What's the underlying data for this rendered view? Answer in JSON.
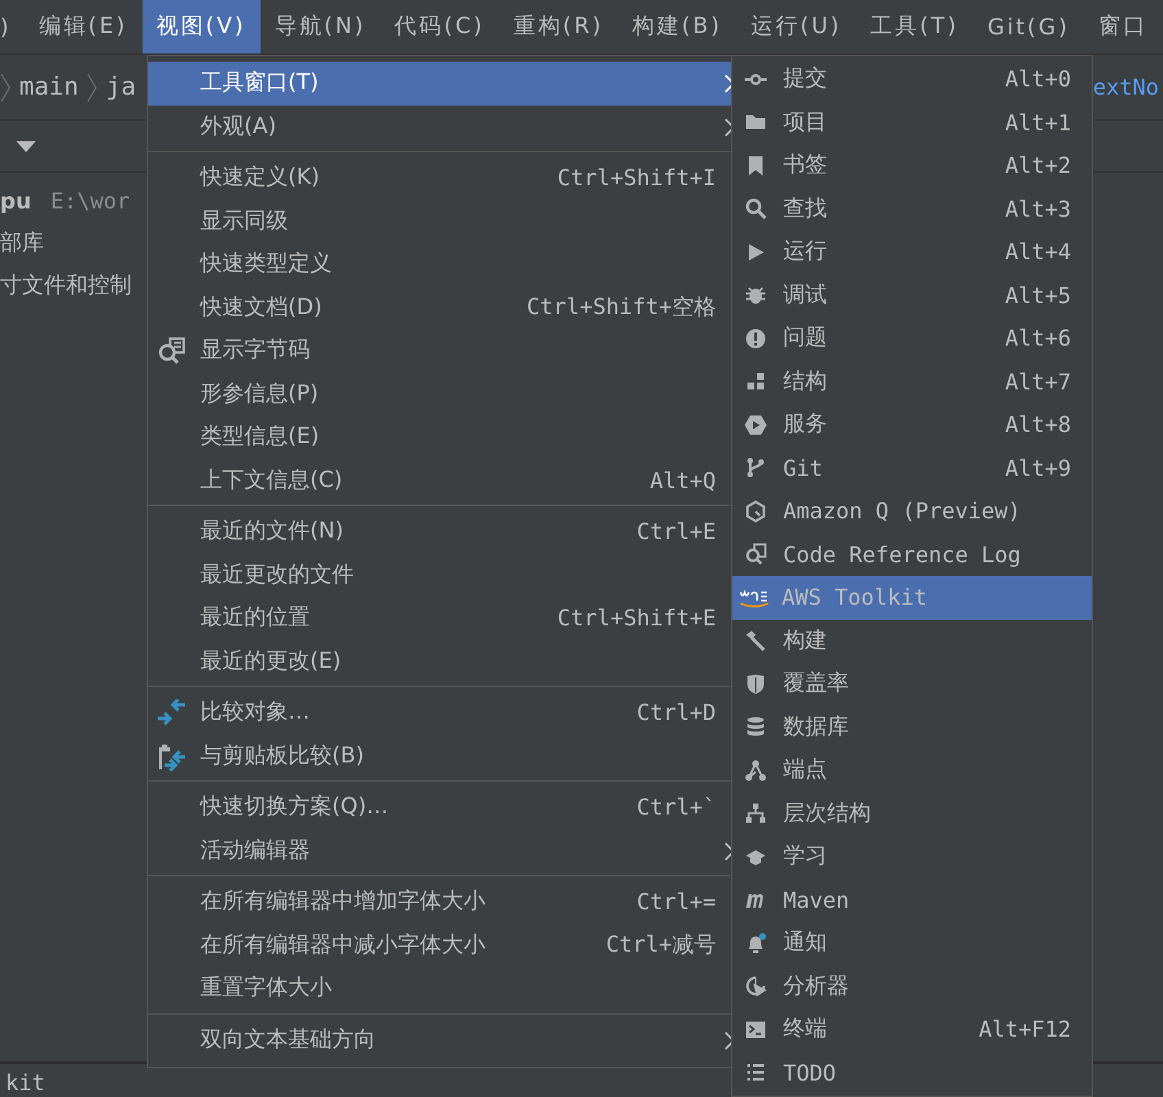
{
  "menubar": {
    "items": [
      {
        "label": ")",
        "selected": false
      },
      {
        "label": "编辑(E)",
        "selected": false
      },
      {
        "label": "视图(V)",
        "selected": true
      },
      {
        "label": "导航(N)",
        "selected": false
      },
      {
        "label": "代码(C)",
        "selected": false
      },
      {
        "label": "重构(R)",
        "selected": false
      },
      {
        "label": "构建(B)",
        "selected": false
      },
      {
        "label": "运行(U)",
        "selected": false
      },
      {
        "label": "工具(T)",
        "selected": false
      },
      {
        "label": "Git(G)",
        "selected": false
      },
      {
        "label": "窗口",
        "selected": false
      }
    ]
  },
  "breadcrumb": {
    "items": [
      "main",
      "ja"
    ],
    "link": "extNo"
  },
  "project_tree": {
    "root": {
      "name": "pu",
      "path": "E:\\wor"
    },
    "items": [
      "部库",
      "寸文件和控制"
    ]
  },
  "bottom_panel": {
    "title": "kit"
  },
  "view_menu": {
    "groups": [
      [
        {
          "label": "工具窗口(T)",
          "selected": true,
          "submenu": true
        },
        {
          "label": "外观(A)",
          "selected": false,
          "submenu": true
        }
      ],
      [
        {
          "label": "快速定义(K)",
          "shortcut": "Ctrl+Shift+I",
          "selected": false,
          "submenu": false
        },
        {
          "label": "显示同级",
          "selected": false,
          "submenu": false
        },
        {
          "label": "快速类型定义",
          "selected": false,
          "submenu": false
        },
        {
          "label": "快速文档(D)",
          "shortcut": "Ctrl+Shift+空格",
          "selected": false,
          "submenu": false
        },
        {
          "label": "显示字节码",
          "selected": false,
          "submenu": false,
          "kind": "bytecode"
        },
        {
          "label": "形参信息(P)",
          "selected": false,
          "submenu": false
        },
        {
          "label": "类型信息(E)",
          "selected": false,
          "submenu": false
        },
        {
          "label": "上下文信息(C)",
          "shortcut": "Alt+Q",
          "selected": false,
          "submenu": false
        }
      ],
      [
        {
          "label": "最近的文件(N)",
          "shortcut": "Ctrl+E",
          "selected": false,
          "submenu": false
        },
        {
          "label": "最近更改的文件",
          "selected": false,
          "submenu": false
        },
        {
          "label": "最近的位置",
          "shortcut": "Ctrl+Shift+E",
          "selected": false,
          "submenu": false
        },
        {
          "label": "最近的更改(E)",
          "selected": false,
          "submenu": false
        }
      ],
      [
        {
          "label": "比较对象…",
          "shortcut": "Ctrl+D",
          "selected": false,
          "submenu": false,
          "kind": "compare"
        },
        {
          "label": "与剪贴板比较(B)",
          "selected": false,
          "submenu": false,
          "kind": "clipboard"
        }
      ],
      [
        {
          "label": "快速切换方案(Q)…",
          "shortcut": "Ctrl+`",
          "selected": false,
          "submenu": false
        },
        {
          "label": "活动编辑器",
          "selected": false,
          "submenu": true
        }
      ],
      [
        {
          "label": "在所有编辑器中增加字体大小",
          "shortcut": "Ctrl+=",
          "selected": false,
          "submenu": false
        },
        {
          "label": "在所有编辑器中减小字体大小",
          "shortcut": "Ctrl+减号",
          "selected": false,
          "submenu": false
        },
        {
          "label": "重置字体大小",
          "selected": false,
          "submenu": false
        }
      ],
      [
        {
          "label": "双向文本基础方向",
          "selected": false,
          "submenu": true
        }
      ]
    ]
  },
  "tool_windows_menu": {
    "items": [
      {
        "label": "提交",
        "shortcut": "Alt+0",
        "selected": false
      },
      {
        "label": "项目",
        "shortcut": "Alt+1",
        "selected": false
      },
      {
        "label": "书签",
        "shortcut": "Alt+2",
        "selected": false
      },
      {
        "label": "查找",
        "shortcut": "Alt+3",
        "selected": false
      },
      {
        "label": "运行",
        "shortcut": "Alt+4",
        "selected": false
      },
      {
        "label": "调试",
        "shortcut": "Alt+5",
        "selected": false
      },
      {
        "label": "问题",
        "shortcut": "Alt+6",
        "selected": false
      },
      {
        "label": "结构",
        "shortcut": "Alt+7",
        "selected": false
      },
      {
        "label": "服务",
        "shortcut": "Alt+8",
        "selected": false
      },
      {
        "label": "Git",
        "shortcut": "Alt+9",
        "selected": false
      },
      {
        "label": "Amazon Q (Preview)",
        "selected": false
      },
      {
        "label": "Code Reference Log",
        "selected": false
      },
      {
        "label": "AWS Toolkit",
        "selected": true
      },
      {
        "label": "构建",
        "selected": false
      },
      {
        "label": "覆盖率",
        "selected": false
      },
      {
        "label": "数据库",
        "selected": false
      },
      {
        "label": "端点",
        "selected": false
      },
      {
        "label": "层次结构",
        "selected": false
      },
      {
        "label": "学习",
        "selected": false
      },
      {
        "label": "Maven",
        "selected": false
      },
      {
        "label": "通知",
        "selected": false
      },
      {
        "label": "分析器",
        "selected": false
      },
      {
        "label": "终端",
        "shortcut": "Alt+F12",
        "selected": false
      },
      {
        "label": "TODO",
        "selected": false
      }
    ]
  }
}
